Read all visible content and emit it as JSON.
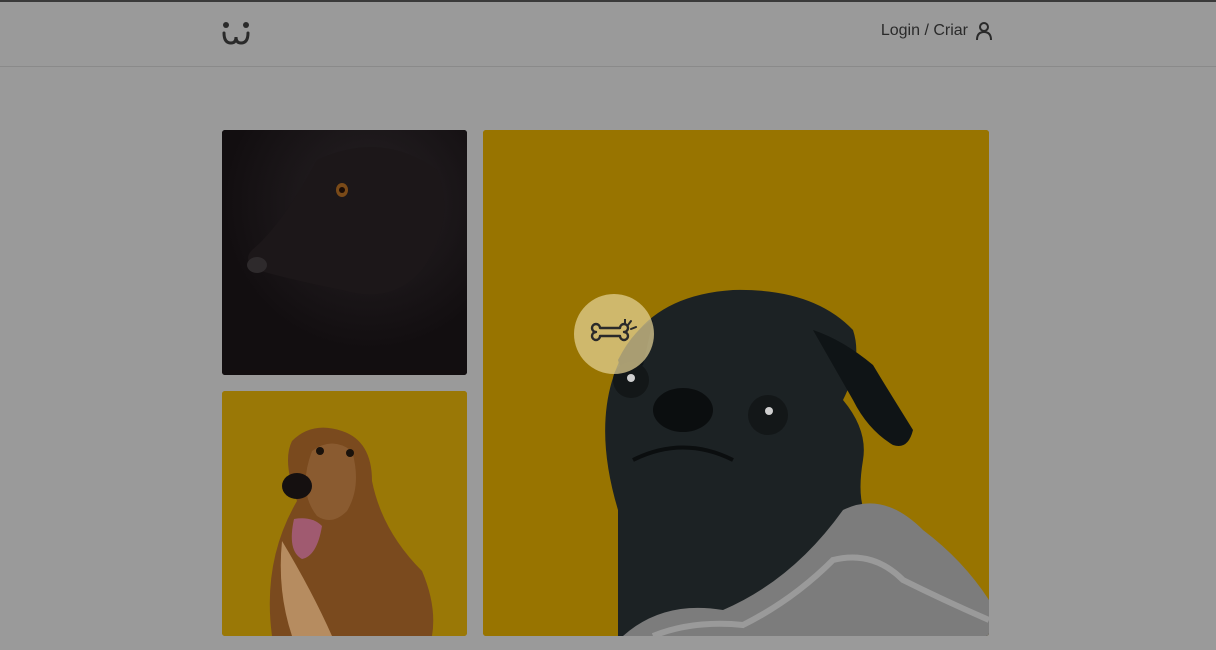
{
  "header": {
    "logo_icon": "dog-face-icon",
    "login_label": "Login / Criar",
    "user_icon": "user-icon"
  },
  "feed": {
    "photos": [
      {
        "name": "black-dog-photo"
      },
      {
        "name": "afghan-hound-photo"
      },
      {
        "name": "pug-photo"
      }
    ]
  },
  "loader": {
    "icon": "bone-icon"
  },
  "colors": {
    "overlay_bg": "#9a9a9a",
    "mustard": "#987400",
    "dark": "#141012"
  }
}
